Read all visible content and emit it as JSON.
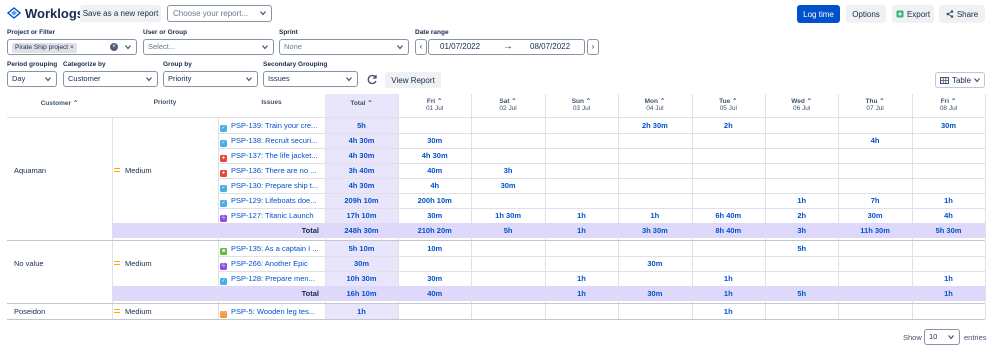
{
  "app": {
    "title": "Worklogs"
  },
  "toolbar": {
    "save_label": "Save as a new report",
    "report_placeholder": "Choose your report...",
    "log_time": "Log time",
    "options": "Options",
    "export": "Export",
    "share": "Share"
  },
  "filters": {
    "project": {
      "label": "Project or Filter",
      "tag": "Pirate Ship project",
      "tag_remove": "×",
      "clear": "×"
    },
    "user": {
      "label": "User or Group",
      "placeholder": "Select..."
    },
    "sprint": {
      "label": "Sprint",
      "value": "None"
    },
    "date": {
      "label": "Date range",
      "from": "01/07/2022",
      "to": "08/07/2022",
      "arrow": "→",
      "prev": "‹",
      "next": "›"
    },
    "period": {
      "label": "Period grouping",
      "value": "Day"
    },
    "categorize": {
      "label": "Categorize by",
      "value": "Customer"
    },
    "groupby": {
      "label": "Group by",
      "value": "Priority"
    },
    "secondary": {
      "label": "Secondary Grouping",
      "value": "Issues"
    },
    "view_report": "View Report",
    "view_mode": "Table"
  },
  "table": {
    "headers": {
      "customer": "Customer",
      "priority": "Priority",
      "issues": "Issues",
      "total": "Total"
    },
    "days": [
      {
        "name": "Fri",
        "date": "01 Jul"
      },
      {
        "name": "Sat",
        "date": "02 Jul"
      },
      {
        "name": "Sun",
        "date": "03 Jul"
      },
      {
        "name": "Mon",
        "date": "04 Jul"
      },
      {
        "name": "Tue",
        "date": "05 Jul"
      },
      {
        "name": "Wed",
        "date": "06 Jul"
      },
      {
        "name": "Thu",
        "date": "07 Jul"
      },
      {
        "name": "Fri",
        "date": "08 Jul"
      }
    ],
    "groups": [
      {
        "customer": "Aquaman",
        "priority": "Medium",
        "rows": [
          {
            "key": "PSP-139",
            "summary": "PSP-139: Train your cre...",
            "type": "task",
            "total": "5h",
            "days": [
              "",
              "",
              "",
              "2h 30m",
              "2h",
              "",
              "",
              "30m"
            ]
          },
          {
            "key": "PSP-138",
            "summary": "PSP-138: Recruit securi...",
            "type": "task",
            "total": "4h 30m",
            "days": [
              "30m",
              "",
              "",
              "",
              "",
              "",
              "4h",
              ""
            ]
          },
          {
            "key": "PSP-137",
            "summary": "PSP-137: The life jacket...",
            "type": "bug",
            "total": "4h 30m",
            "days": [
              "4h 30m",
              "",
              "",
              "",
              "",
              "",
              "",
              ""
            ]
          },
          {
            "key": "PSP-136",
            "summary": "PSP-136: There are no ...",
            "type": "bug",
            "total": "3h 40m",
            "days": [
              "40m",
              "3h",
              "",
              "",
              "",
              "",
              "",
              ""
            ]
          },
          {
            "key": "PSP-130",
            "summary": "PSP-130: Prepare ship t...",
            "type": "task",
            "total": "4h 30m",
            "days": [
              "4h",
              "30m",
              "",
              "",
              "",
              "",
              "",
              ""
            ]
          },
          {
            "key": "PSP-129",
            "summary": "PSP-129: Lifeboats doe...",
            "type": "task",
            "total": "209h 10m",
            "days": [
              "200h 10m",
              "",
              "",
              "",
              "",
              "1h",
              "7h",
              "1h"
            ]
          },
          {
            "key": "PSP-127",
            "summary": "PSP-127: Titanic Launch",
            "type": "epic",
            "total": "17h 10m",
            "days": [
              "30m",
              "1h 30m",
              "1h",
              "1h",
              "6h 40m",
              "2h",
              "30m",
              "4h"
            ]
          }
        ],
        "total_label": "Total",
        "total": "248h 30m",
        "totals": [
          "210h 20m",
          "5h",
          "1h",
          "3h 30m",
          "8h 40m",
          "3h",
          "11h 30m",
          "5h 30m"
        ]
      },
      {
        "customer": "No value",
        "priority": "Medium",
        "rows": [
          {
            "key": "PSP-135",
            "summary": "PSP-135: As a captain I ...",
            "type": "story",
            "total": "5h 10m",
            "days": [
              "10m",
              "",
              "",
              "",
              "",
              "5h",
              "",
              ""
            ]
          },
          {
            "key": "PSP-266",
            "summary": "PSP-266: Another Epic",
            "type": "epic",
            "total": "30m",
            "days": [
              "",
              "",
              "",
              "30m",
              "",
              "",
              "",
              ""
            ]
          },
          {
            "key": "PSP-128",
            "summary": "PSP-128: Prepare men...",
            "type": "task",
            "total": "10h 30m",
            "days": [
              "30m",
              "",
              "1h",
              "",
              "1h",
              "",
              "",
              "1h"
            ]
          }
        ],
        "total_label": "Total",
        "total": "16h 10m",
        "totals": [
          "40m",
          "",
          "1h",
          "30m",
          "1h",
          "5h",
          "",
          "1h"
        ]
      },
      {
        "customer": "Poseidon",
        "priority": "Medium",
        "rows": [
          {
            "key": "PSP-5",
            "summary": "PSP-5: Wooden leg tes...",
            "type": "subtask",
            "total": "1h",
            "days": [
              "",
              "",
              "",
              "",
              "1h",
              "",
              "",
              ""
            ]
          }
        ]
      }
    ]
  },
  "pagination": {
    "show_label": "Show",
    "value": "10",
    "entries_label": "entries"
  },
  "colors": {
    "accent": "#0052cc",
    "total_col": "#e9e6fb",
    "total_row": "#ded9fa",
    "task": "#4bade8",
    "bug": "#e5493a",
    "epic": "#904ee2",
    "story": "#63ba3c",
    "subtask": "#f79232",
    "priority_medium": "#ffab00"
  }
}
